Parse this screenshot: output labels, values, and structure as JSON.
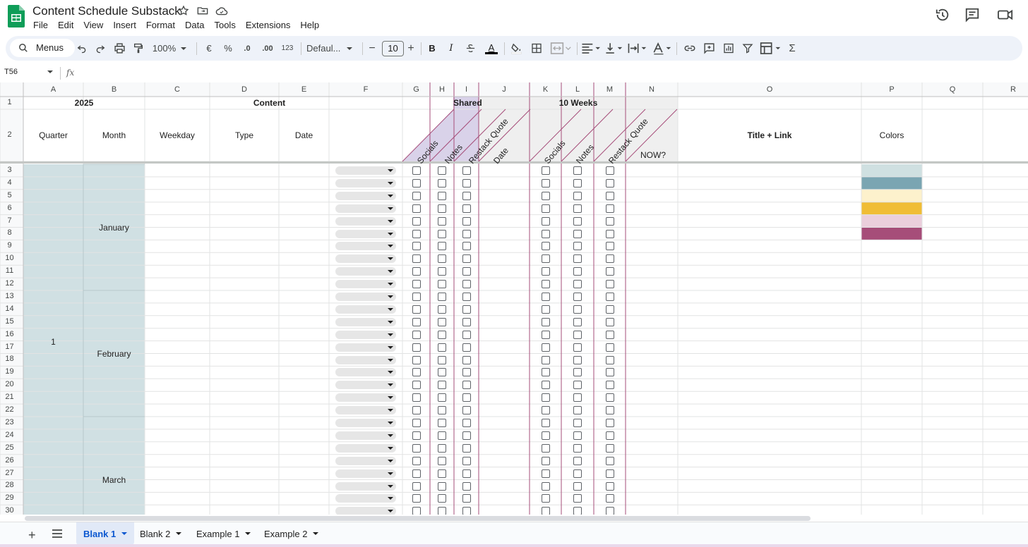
{
  "app": {
    "title": "Content Schedule Substack",
    "menu": [
      "File",
      "Edit",
      "View",
      "Insert",
      "Format",
      "Data",
      "Tools",
      "Extensions",
      "Help"
    ]
  },
  "toolbar": {
    "search_label": "Menus",
    "zoom": "100%",
    "currency": "€",
    "percent": "%",
    "decrease_decimal": ".0",
    "increase_decimal": ".00",
    "number_format": "123",
    "font": "Defaul...",
    "font_size": "10",
    "bold": "B",
    "italic": "I",
    "text_color": "A"
  },
  "formula_bar": {
    "name_box": "T56",
    "fx": "fx",
    "value": ""
  },
  "grid": {
    "columns": [
      "A",
      "B",
      "C",
      "D",
      "E",
      "F",
      "G",
      "H",
      "I",
      "J",
      "K",
      "L",
      "M",
      "N",
      "O",
      "P",
      "Q",
      "R"
    ],
    "rows": [
      "1",
      "2",
      "3",
      "4",
      "5",
      "6",
      "7",
      "8",
      "9",
      "10",
      "11",
      "12",
      "13",
      "14",
      "15",
      "16",
      "17",
      "18",
      "19",
      "20",
      "21",
      "22",
      "23",
      "24",
      "25",
      "26",
      "27",
      "28",
      "29",
      "30"
    ],
    "row1": {
      "year": "2025",
      "content": "Content",
      "shared": "Shared",
      "ten_weeks": "10 Weeks"
    },
    "row2": {
      "quarter": "Quarter",
      "month": "Month",
      "weekday": "Weekday",
      "type": "Type",
      "date": "Date",
      "shared_socials": "Socials",
      "shared_notes": "Notes",
      "shared_restack": "Restack Quote",
      "weeks_date": "Date",
      "weeks_socials": "Socials",
      "weeks_notes": "Notes",
      "weeks_restack": "Restack Quote",
      "now": "NOW?",
      "title_link": "Title + Link",
      "colors": "Colors"
    },
    "quarter_value": "1",
    "months": [
      "January",
      "February",
      "March"
    ],
    "palette": [
      "#cfe0e1",
      "#7aa5b2",
      "#fdf1cc",
      "#f0bd36",
      "#ebcfdc",
      "#a64d79"
    ],
    "colors": {
      "header_fill": "#f3f3f3",
      "quarter_fill": "#d0e0e3",
      "shared_fill": "#d9d2e9",
      "weeks_fill": "#efefef",
      "accent_line": "#a64d79"
    }
  },
  "sheets": {
    "tabs": [
      "Blank 1",
      "Blank 2",
      "Example 1",
      "Example 2"
    ],
    "active": "Blank 1"
  }
}
